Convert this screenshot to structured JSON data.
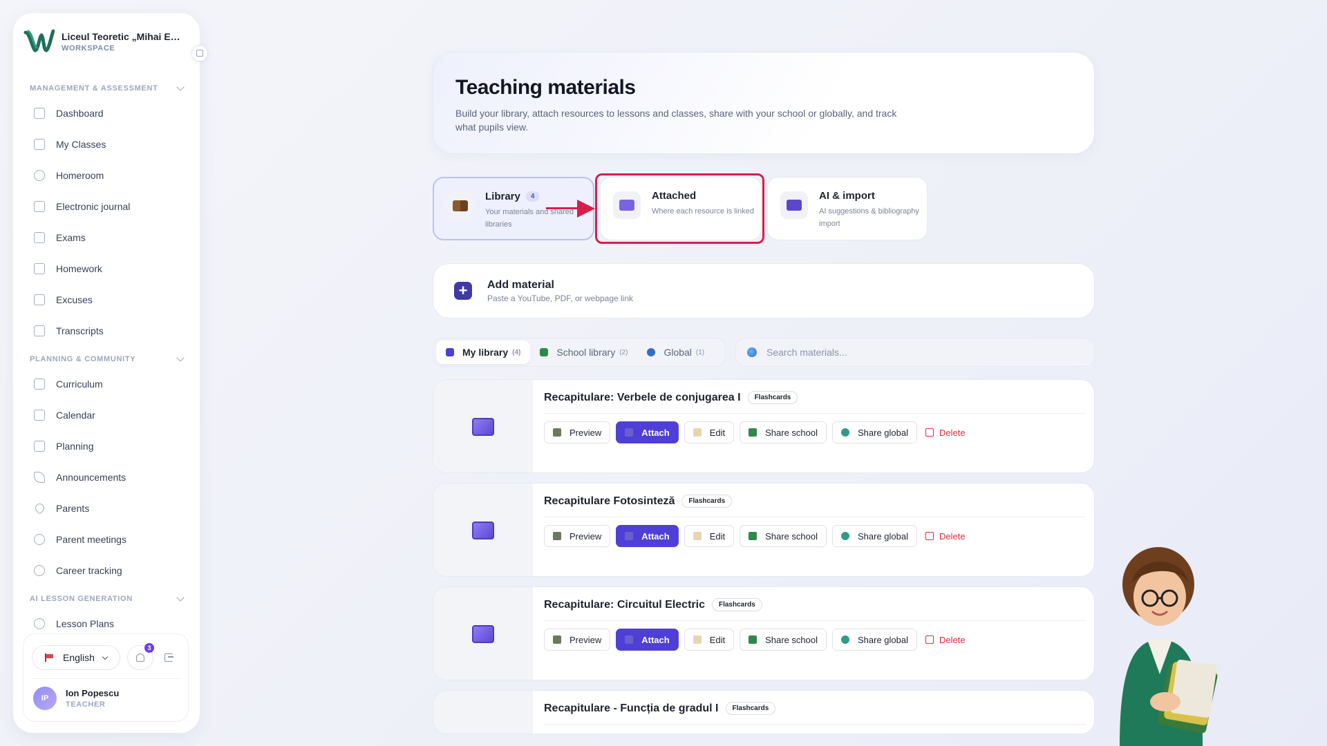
{
  "workspace": {
    "name": "Liceul Teoretic „Mihai Emi...",
    "subtitle": "WORKSPACE"
  },
  "sidebar": {
    "sections": [
      {
        "title": "MANAGEMENT & ASSESSMENT",
        "items": [
          "Dashboard",
          "My Classes",
          "Homeroom",
          "Electronic journal",
          "Exams",
          "Homework",
          "Excuses",
          "Transcripts"
        ]
      },
      {
        "title": "PLANNING & COMMUNITY",
        "items": [
          "Curriculum",
          "Calendar",
          "Planning",
          "Announcements",
          "Parents",
          "Parent meetings",
          "Career tracking"
        ]
      },
      {
        "title": "AI LESSON GENERATION",
        "items": [
          "Lesson Plans"
        ]
      }
    ],
    "language": "English",
    "notifications": "3",
    "user": {
      "initials": "IP",
      "name": "Ion Popescu",
      "role": "TEACHER"
    }
  },
  "hero": {
    "title": "Teaching materials",
    "description": "Build your library, attach resources to lessons and classes, share with your school or globally, and track what pupils view."
  },
  "view_tabs": [
    {
      "title": "Library",
      "count": "4",
      "desc": "Your materials and shared libraries",
      "icon": "book-icon"
    },
    {
      "title": "Attached",
      "desc": "Where each resource is linked",
      "icon": "folder-icon"
    },
    {
      "title": "AI & import",
      "desc": "AI suggestions & bibliography import",
      "icon": "ai-import-icon"
    }
  ],
  "add_material": {
    "title": "Add material",
    "subtitle": "Paste a YouTube, PDF, or webpage link"
  },
  "library_tabs": [
    {
      "label": "My library",
      "count": "(4)",
      "color": "#4f3fd6"
    },
    {
      "label": "School library",
      "count": "(2)",
      "color": "#2f8a4a"
    },
    {
      "label": "Global",
      "count": "(1)",
      "color": "#2f6fc8"
    }
  ],
  "search": {
    "placeholder": "Search materials..."
  },
  "actions": {
    "preview": "Preview",
    "attach": "Attach",
    "edit": "Edit",
    "share_school": "Share school",
    "share_global": "Share global",
    "delete": "Delete"
  },
  "materials": [
    {
      "title": "Recapitulare: Verbele de conjugarea I",
      "type": "Flashcards"
    },
    {
      "title": "Recapitulare Fotosinteză",
      "type": "Flashcards"
    },
    {
      "title": "Recapitulare: Circuitul Electric",
      "type": "Flashcards"
    },
    {
      "title": "Recapitulare - Funcția de gradul I",
      "type": "Flashcards"
    }
  ]
}
